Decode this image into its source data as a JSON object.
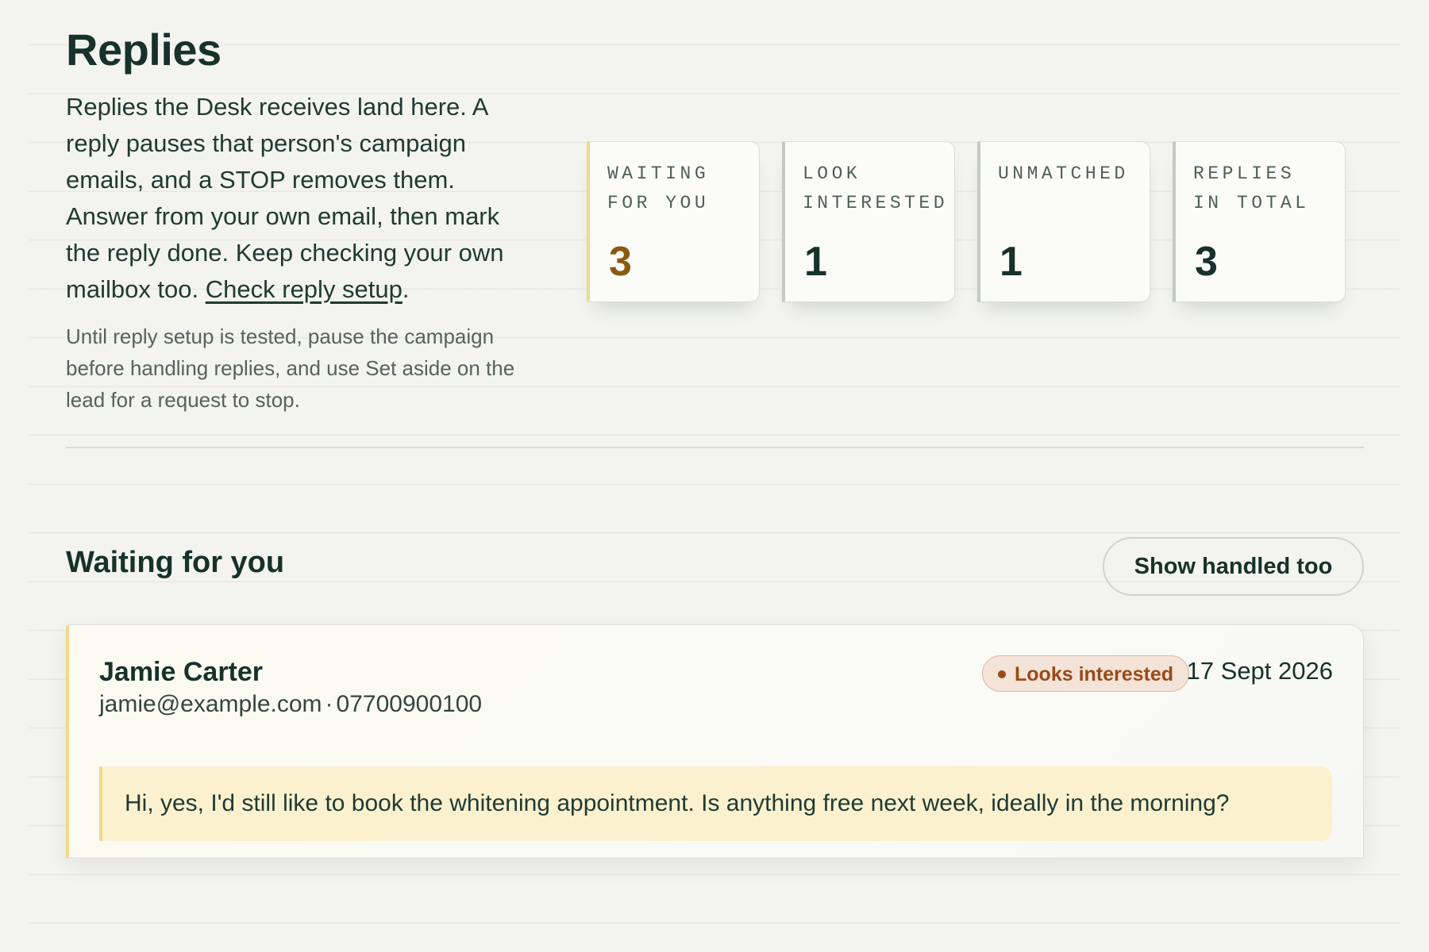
{
  "header": {
    "title": "Replies",
    "intro_text": "Replies the Desk receives land here. A reply pauses that person's campaign emails, and a STOP removes them. Answer from your own email, then mark the reply done. Keep checking your own mailbox too.",
    "setup_link": "Check reply setup",
    "note": "Until reply setup is tested, pause the campaign before handling replies, and use Set aside on the lead for a request to stop."
  },
  "stats": [
    {
      "label": "Waiting for you",
      "value": "3",
      "accent": "#8a5a0f"
    },
    {
      "label": "Look interested",
      "value": "1"
    },
    {
      "label": "Unmatched",
      "value": "1"
    },
    {
      "label": "Replies in total",
      "value": "3"
    }
  ],
  "section": {
    "title": "Waiting for you",
    "toggle_label": "Show handled too"
  },
  "replies": [
    {
      "name": "Jamie Carter",
      "email": "jamie@example.com",
      "separator": "·",
      "phone": "07700900100",
      "badge": "Looks interested",
      "date": "17 Sept 2026",
      "message": "Hi, yes, I'd still like to book the whitening appointment. Is anything free next week, ideally in the morning?"
    }
  ],
  "colors": {
    "background": "#f3f3ef",
    "text": "#17312b",
    "accent_yellow": "#f0d98a",
    "message_bg": "#fbf1cf",
    "badge_text": "#9a4a17",
    "badge_bg": "#f3e3d8"
  }
}
